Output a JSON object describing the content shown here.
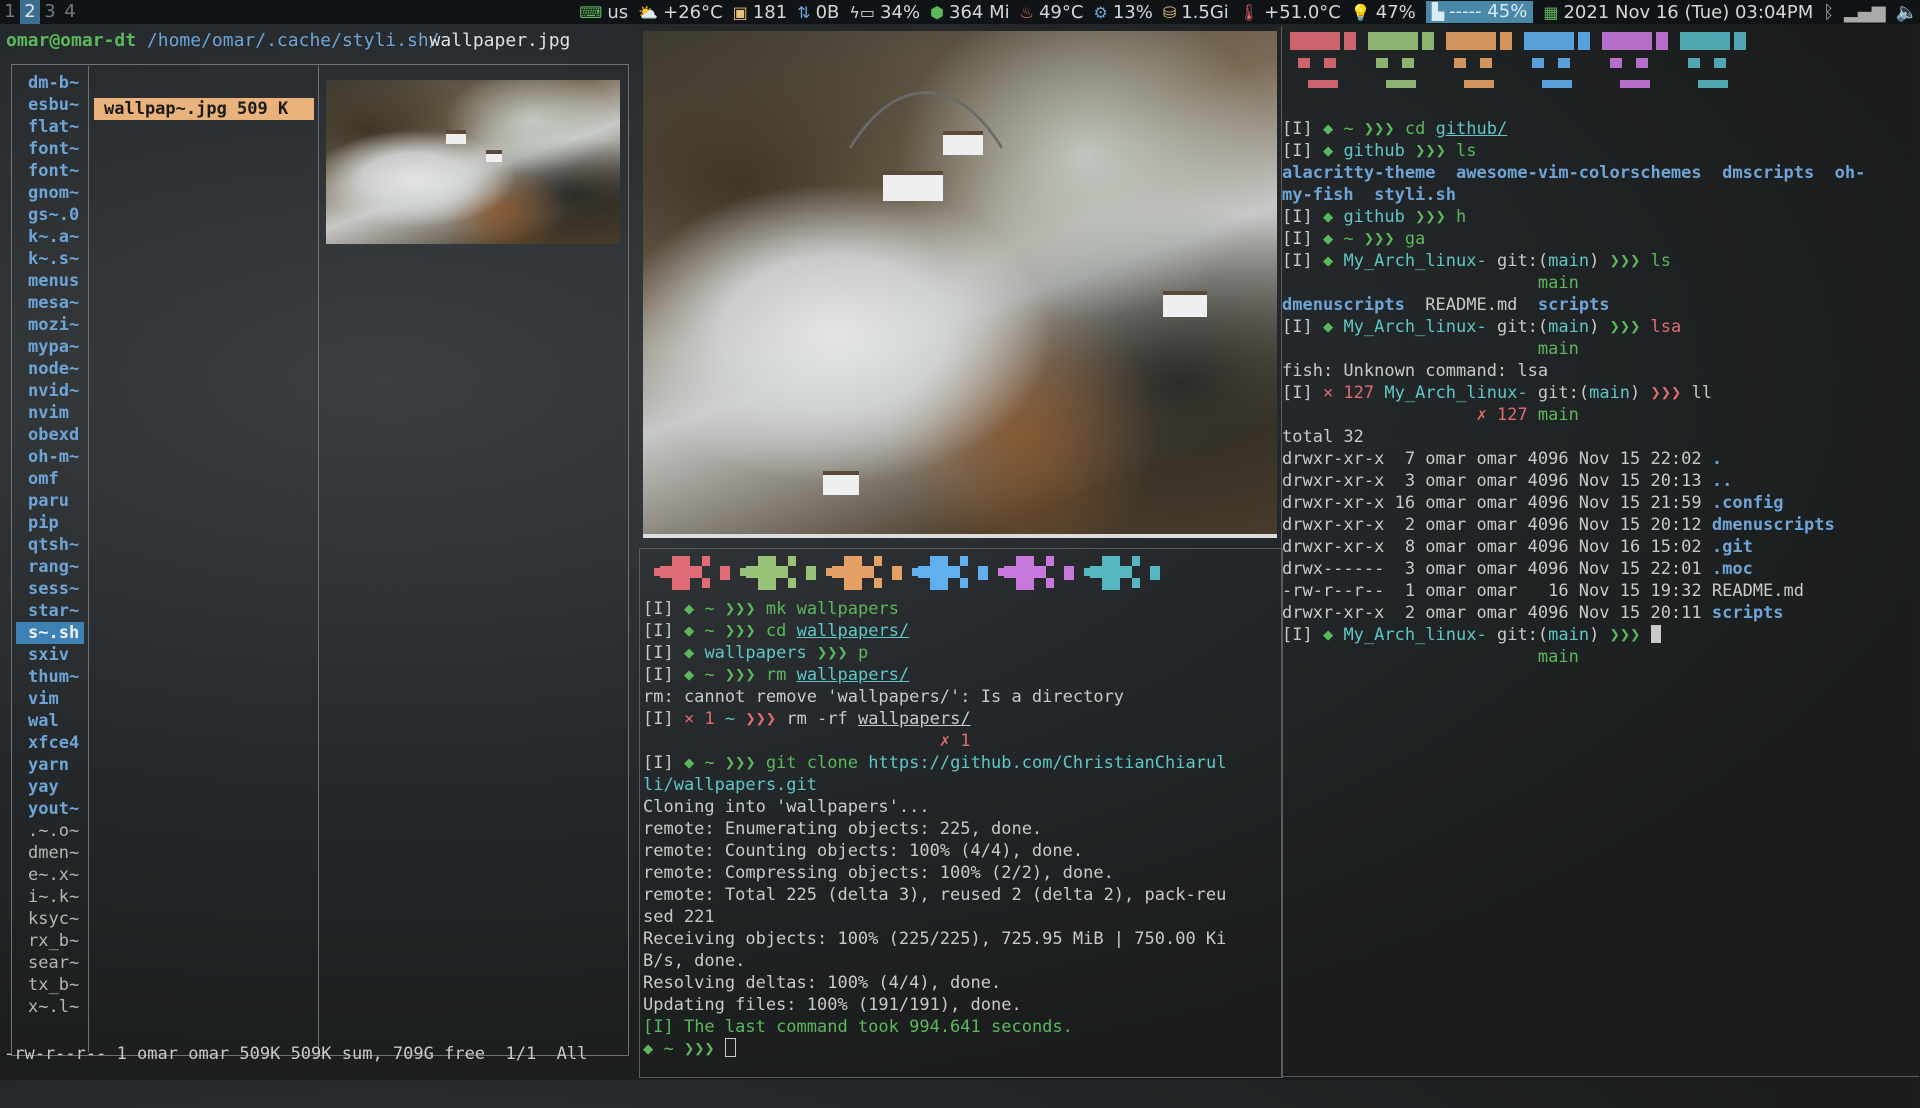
{
  "topbar": {
    "workspaces": [
      "1",
      "2",
      "3",
      "4"
    ],
    "active_workspace": "2",
    "keyboard": "us",
    "weather": "+26°C",
    "updates": "181",
    "net_down": "0B",
    "battery": "34%",
    "memory": "364 Mi",
    "cpu_temp": "49°C",
    "cpu_load": "13%",
    "disk": "1.5Gi",
    "temp2": "+51.0°C",
    "brightness": "47%",
    "volume_bar": "----- 45%",
    "volume_level": 0.45,
    "datetime": "2021 Nov 16 (Tue) 03:04PM"
  },
  "ranger": {
    "user_host": "omar@omar-dt",
    "path_dir": "/home/omar/.cache/styli.sh/",
    "path_file": "wallpaper.jpg",
    "dirs": [
      "dm-b~",
      "esbu~",
      "flat~",
      "font~",
      "font~",
      "gnom~",
      "gs~.0",
      "k~.a~",
      "k~.s~",
      "menus",
      "mesa~",
      "mozi~",
      "mypa~",
      "node~",
      "nvid~",
      "nvim",
      "obexd",
      "oh-m~",
      "omf",
      "paru",
      "pip",
      "qtsh~",
      "rang~",
      "sess~",
      "star~",
      "s~.sh",
      "sxiv",
      "thum~",
      "vim",
      "wal",
      "xfce4",
      "yarn",
      "yay",
      "yout~"
    ],
    "dim_items": [
      ".~.o~",
      "dmen~",
      "e~.x~",
      "i~.k~",
      "ksyc~",
      "rx_b~",
      "sear~",
      "tx_b~",
      "x~.l~"
    ],
    "selected_dir": "s~.sh",
    "selected_file": "wallpap~.jpg 509 K",
    "status": "-rw-r--r-- 1 omar omar 509K 509K sum, 709G free  1/1  All"
  },
  "term_mid": {
    "lines": [
      {
        "parts": [
          [
            "w",
            "[I] "
          ],
          [
            "g",
            "◆ ~ "
          ],
          [
            "g",
            "❯❯❯ "
          ],
          [
            "g",
            "mk "
          ],
          [
            "g",
            "wallpapers"
          ]
        ]
      },
      {
        "parts": [
          [
            "w",
            "[I] "
          ],
          [
            "g",
            "◆ ~ "
          ],
          [
            "g",
            "❯❯❯ "
          ],
          [
            "g",
            "cd "
          ],
          [
            "c u",
            "wallpapers/"
          ]
        ]
      },
      {
        "parts": [
          [
            "w",
            "[I] "
          ],
          [
            "g",
            "◆ "
          ],
          [
            "c",
            "wallpapers "
          ],
          [
            "g",
            "❯❯❯ "
          ],
          [
            "g",
            "p"
          ]
        ]
      },
      {
        "parts": [
          [
            "w",
            "[I] "
          ],
          [
            "g",
            "◆ ~ "
          ],
          [
            "g",
            "❯❯❯ "
          ],
          [
            "g",
            "rm "
          ],
          [
            "c u",
            "wallpapers/"
          ]
        ]
      },
      {
        "parts": [
          [
            "w",
            "rm: cannot remove 'wallpapers/': Is a directory"
          ]
        ]
      },
      {
        "parts": [
          [
            "w",
            "[I] "
          ],
          [
            "r",
            "× 1 "
          ],
          [
            "c",
            "~ "
          ],
          [
            "r",
            "❯❯❯ "
          ],
          [
            "w",
            "rm -rf "
          ],
          [
            "w u",
            "wallpapers/"
          ]
        ]
      },
      {
        "parts": [
          [
            "r",
            "                             ✗ 1"
          ]
        ]
      },
      {
        "parts": [
          [
            "w",
            "[I] "
          ],
          [
            "g",
            "◆ ~ "
          ],
          [
            "g",
            "❯❯❯ "
          ],
          [
            "g",
            "git clone "
          ],
          [
            "c",
            "https://github.com/ChristianChiarul"
          ]
        ]
      },
      {
        "parts": [
          [
            "c",
            "li/wallpapers.git"
          ]
        ]
      },
      {
        "parts": [
          [
            "w",
            "Cloning into 'wallpapers'..."
          ]
        ]
      },
      {
        "parts": [
          [
            "w",
            "remote: Enumerating objects: 225, done."
          ]
        ]
      },
      {
        "parts": [
          [
            "w",
            "remote: Counting objects: 100% (4/4), done."
          ]
        ]
      },
      {
        "parts": [
          [
            "w",
            "remote: Compressing objects: 100% (2/2), done."
          ]
        ]
      },
      {
        "parts": [
          [
            "w",
            "remote: Total 225 (delta 3), reused 2 (delta 2), pack-reu"
          ]
        ]
      },
      {
        "parts": [
          [
            "w",
            "sed 221"
          ]
        ]
      },
      {
        "parts": [
          [
            "w",
            "Receiving objects: 100% (225/225), 725.95 MiB | 750.00 Ki"
          ]
        ]
      },
      {
        "parts": [
          [
            "w",
            "B/s, done."
          ]
        ]
      },
      {
        "parts": [
          [
            "w",
            "Resolving deltas: 100% (4/4), done."
          ]
        ]
      },
      {
        "parts": [
          [
            "w",
            "Updating files: 100% (191/191), done."
          ]
        ]
      },
      {
        "parts": [
          [
            "g",
            "[I] "
          ],
          [
            "g",
            "The last command took 994.641 seconds."
          ]
        ]
      },
      {
        "parts": [
          [
            "g",
            "◆ ~ "
          ],
          [
            "g",
            "❯❯❯ "
          ]
        ]
      }
    ]
  },
  "term_right": {
    "lines": [
      {
        "parts": [
          [
            "w",
            "[I] "
          ],
          [
            "g",
            "◆ ~ "
          ],
          [
            "g",
            "❯❯❯ "
          ],
          [
            "g",
            "cd "
          ],
          [
            "c u",
            "github/"
          ]
        ]
      },
      {
        "parts": [
          [
            "w",
            "[I] "
          ],
          [
            "g",
            "◆ "
          ],
          [
            "c",
            "github "
          ],
          [
            "g",
            "❯❯❯ "
          ],
          [
            "g",
            "ls"
          ]
        ]
      },
      {
        "parts": [
          [
            "b",
            "alacritty-theme  awesome-vim-colorschemes  dmscripts  oh-"
          ]
        ]
      },
      {
        "parts": [
          [
            "b",
            "my-fish  styli.sh"
          ]
        ]
      },
      {
        "parts": [
          [
            "w",
            "[I] "
          ],
          [
            "g",
            "◆ "
          ],
          [
            "c",
            "github "
          ],
          [
            "g",
            "❯❯❯ "
          ],
          [
            "g",
            "h"
          ]
        ]
      },
      {
        "parts": [
          [
            "w",
            "[I] "
          ],
          [
            "g",
            "◆ ~ "
          ],
          [
            "g",
            "❯❯❯ "
          ],
          [
            "g",
            "ga"
          ]
        ]
      },
      {
        "parts": [
          [
            "w",
            "[I] "
          ],
          [
            "g",
            "◆ "
          ],
          [
            "c",
            "My_Arch_linux- "
          ],
          [
            "w",
            "git:("
          ],
          [
            "c",
            "main"
          ],
          [
            "w",
            ") "
          ],
          [
            "g",
            "❯❯❯ "
          ],
          [
            "g",
            "ls"
          ]
        ]
      },
      {
        "parts": [
          [
            "g",
            "                         main"
          ]
        ]
      },
      {
        "parts": [
          [
            "b",
            "dmenuscripts  "
          ],
          [
            "w",
            "README.md  "
          ],
          [
            "b",
            "scripts"
          ]
        ]
      },
      {
        "parts": [
          [
            "w",
            "[I] "
          ],
          [
            "g",
            "◆ "
          ],
          [
            "c",
            "My_Arch_linux- "
          ],
          [
            "w",
            "git:("
          ],
          [
            "c",
            "main"
          ],
          [
            "w",
            ") "
          ],
          [
            "g",
            "❯❯❯ "
          ],
          [
            "r",
            "lsa"
          ]
        ]
      },
      {
        "parts": [
          [
            "g",
            "                         main"
          ]
        ]
      },
      {
        "parts": [
          [
            "w",
            "fish: Unknown command: lsa"
          ]
        ]
      },
      {
        "parts": [
          [
            "w",
            "[I] "
          ],
          [
            "r",
            "× 127 "
          ],
          [
            "c",
            "My_Arch_linux- "
          ],
          [
            "w",
            "git:("
          ],
          [
            "c",
            "main"
          ],
          [
            "w",
            ") "
          ],
          [
            "r",
            "❯❯❯ "
          ],
          [
            "w",
            "ll"
          ]
        ]
      },
      {
        "parts": [
          [
            "r",
            "                   ✗ 127 "
          ],
          [
            "g",
            "main"
          ]
        ]
      },
      {
        "parts": [
          [
            "w",
            "total 32"
          ]
        ]
      },
      {
        "parts": [
          [
            "w",
            "drwxr-xr-x  7 omar omar 4096 Nov 15 22:02 "
          ],
          [
            "b",
            "."
          ]
        ]
      },
      {
        "parts": [
          [
            "w",
            "drwxr-xr-x  3 omar omar 4096 Nov 15 20:13 "
          ],
          [
            "b",
            ".."
          ]
        ]
      },
      {
        "parts": [
          [
            "w",
            "drwxr-xr-x 16 omar omar 4096 Nov 15 21:59 "
          ],
          [
            "b",
            ".config"
          ]
        ]
      },
      {
        "parts": [
          [
            "w",
            "drwxr-xr-x  2 omar omar 4096 Nov 15 20:12 "
          ],
          [
            "b",
            "dmenuscripts"
          ]
        ]
      },
      {
        "parts": [
          [
            "w",
            "drwxr-xr-x  8 omar omar 4096 Nov 16 15:02 "
          ],
          [
            "b",
            ".git"
          ]
        ]
      },
      {
        "parts": [
          [
            "w",
            "drwx------  3 omar omar 4096 Nov 15 22:01 "
          ],
          [
            "b",
            ".moc"
          ]
        ]
      },
      {
        "parts": [
          [
            "w",
            "-rw-r--r--  1 omar omar   16 Nov 15 19:32 README.md"
          ]
        ]
      },
      {
        "parts": [
          [
            "w",
            "drwxr-xr-x  2 omar omar 4096 Nov 15 20:11 "
          ],
          [
            "b",
            "scripts"
          ]
        ]
      },
      {
        "parts": [
          [
            "w",
            "[I] "
          ],
          [
            "g",
            "◆ "
          ],
          [
            "c",
            "My_Arch_linux- "
          ],
          [
            "w",
            "git:("
          ],
          [
            "c",
            "main"
          ],
          [
            "w",
            ") "
          ],
          [
            "g",
            "❯❯❯ "
          ]
        ]
      },
      {
        "parts": [
          [
            "g",
            "                         main"
          ]
        ]
      }
    ]
  },
  "colors": {
    "swatches": [
      "#e06c75",
      "#98c379",
      "#e5a165",
      "#61afef",
      "#c678dd",
      "#56b6c2"
    ]
  }
}
